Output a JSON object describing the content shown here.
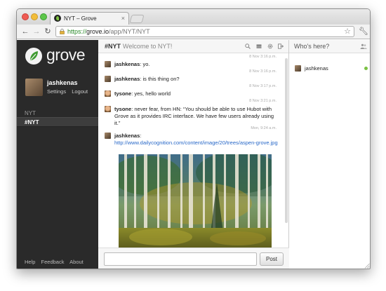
{
  "browser": {
    "tab_title": "NYT – Grove",
    "url_scheme": "https://",
    "url_host": "grove.io",
    "url_path": "/app/NYT/NYT",
    "icons": [
      "back-icon",
      "forward-icon",
      "reload-icon",
      "lock-icon",
      "star-icon",
      "wrench-icon"
    ]
  },
  "sidebar": {
    "logo_text": "grove",
    "user": {
      "name": "jashkenas",
      "settings": "Settings",
      "logout": "Logout"
    },
    "org": "NYT",
    "room": "#NYT",
    "footer": {
      "help": "Help",
      "feedback": "Feedback",
      "about": "About"
    }
  },
  "chat": {
    "room": "#NYT",
    "topic": "Welcome to NYT!",
    "messages": [
      {
        "time": "8 Nov 3:16 p.m.",
        "user": "jashkenas",
        "text": ": yo."
      },
      {
        "time": "8 Nov 3:16 p.m.",
        "user": "jashkenas",
        "text": ": is this thing on?"
      },
      {
        "time": "8 Nov 3:17 p.m.",
        "user": "tysone",
        "text": ": yes, hello world"
      },
      {
        "time": "8 Nov 3:21 p.m.",
        "user": "tysone",
        "text": ": never fear, from HN: “You should be able to use Hubot with Grove as it provides IRC interface. We have few users already using it.”"
      },
      {
        "time": "Mon, 9:24 a.m.",
        "user": "jashkenas",
        "text": ": ",
        "link": "http://www.dailycognition.com/content/image/20/trees/aspen-grove.jpg"
      }
    ],
    "composer_placeholder": "",
    "post_label": "Post"
  },
  "who": {
    "title": "Who's here?",
    "users": [
      {
        "name": "jashkenas",
        "status": "online",
        "status_color": "#7ac143"
      }
    ]
  },
  "colors": {
    "sidebar_bg": "#2a2a2a",
    "link": "#2868c8",
    "online": "#7ac143"
  }
}
